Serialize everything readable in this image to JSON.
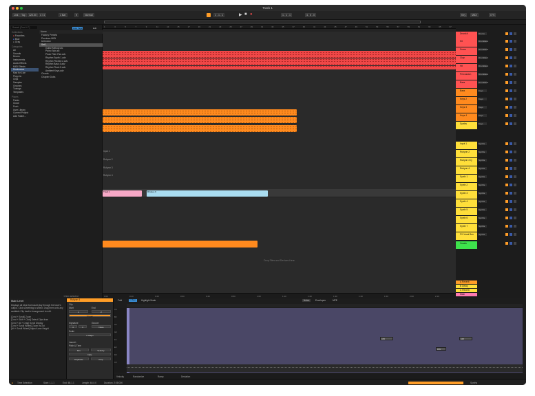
{
  "window": {
    "title": "Track 1"
  },
  "transport": {
    "link": "Link",
    "tap": "Tap",
    "tempo": "120.00",
    "meter": "4 / 4",
    "quant": "1 Bar",
    "position": "1 . 1 . 1",
    "loop_start": "1 . 1 . 1",
    "loop_len": "4 . 0 . 0",
    "key": "Key",
    "midi": "MIDI",
    "cpu": "0 %",
    "mode": "Normal"
  },
  "browser": {
    "search_placeholder": "Search (Cmd + F)",
    "collections_header": "Collections",
    "collections": [
      "Favorites",
      "Blue",
      "Gray"
    ],
    "categories_header": "Categories",
    "categories": [
      "All",
      "Sounds",
      "Drums",
      "Instruments",
      "Audio Effects",
      "MIDI Effects",
      "Modulators",
      "Max for Live",
      "Plug-Ins",
      "Clips",
      "Samples",
      "Grooves",
      "Tunings",
      "Templates"
    ],
    "places_header": "Places",
    "places": [
      "Packs",
      "Cloud",
      "Push",
      "User Library",
      "Current Project",
      "Add Folder..."
    ],
    "column_header": "Name",
    "auto_tags": "Auto Tags",
    "edit": "Edit",
    "files": [
      "Factory Presets",
      "Previews MIDI",
      "Unknown",
      "Set 1",
      "Guitar Melody.alc",
      "Paino Sub.alc",
      "Pluck Filter Pad.adv",
      "Rhythm Synth 1.adv",
      "Rhythm Pitched 2.adv",
      "Rhythm Bass 4.adv",
      "Rhythm Pluck 5.adv",
      "Ambient Keys.adv",
      "Chords",
      "Chapter Dubs"
    ],
    "footer": "1 item selected"
  },
  "ruler": [
    "1",
    "3",
    "5",
    "7",
    "9",
    "11",
    "13",
    "15",
    "17",
    "19",
    "21",
    "23",
    "25",
    "27",
    "29",
    "31",
    "33",
    "35",
    "37",
    "39",
    "41",
    "43",
    "45",
    "47",
    "49",
    "51",
    "53",
    "55",
    "57",
    "59",
    "61",
    "63",
    "65",
    "67"
  ],
  "timebar": [
    "0:00",
    "0:10",
    "0:20",
    "0:30",
    "0:40",
    "0:50",
    "1:00",
    "1:10",
    "1:20",
    "1:30",
    "1:40",
    "1:50",
    "2:00",
    "2:10"
  ],
  "arrangement": {
    "drop_hint": "Drop Files and Devices Here",
    "ghost_clips": [
      "Input 1",
      "Rubyon 2",
      "Rubyon 3",
      "Rubyon 4"
    ],
    "clip_labels": [
      "Track 1",
      "Rhodes 9"
    ]
  },
  "mixer": {
    "tracks": [
      {
        "name": "Drumkit",
        "color": "#ff5252",
        "io": "Drums"
      },
      {
        "name": "Kit",
        "color": "#ff5252",
        "io": "DrumRack"
      },
      {
        "name": "Snare",
        "color": "#ff5252",
        "io": "DrumRack"
      },
      {
        "name": "Clap",
        "color": "#ff5252",
        "io": "DrumRack"
      },
      {
        "name": "Hit",
        "color": "#ff5252",
        "io": "DrumRack"
      },
      {
        "name": "Percussion",
        "color": "#ff5252",
        "io": "DrumRack"
      },
      {
        "name": "Bass",
        "color": "#ff5252",
        "io": "DrumRack"
      },
      {
        "name": "Bass",
        "color": "#ff8a1e",
        "io": "Keys"
      },
      {
        "name": "Keys 2",
        "color": "#ff8a1e",
        "io": "Keys"
      },
      {
        "name": "Keys 3",
        "color": "#ff8a1e",
        "io": "Keys"
      },
      {
        "name": "Keys 4",
        "color": "#ff8a1e",
        "io": "Keys"
      },
      {
        "name": "Synths",
        "color": "#ffdf3a",
        "io": "Keys"
      },
      {
        "name": "Input 1",
        "color": "#ffdf3a",
        "io": "Synths"
      },
      {
        "name": "Rubyon 2",
        "color": "#ffdf3a",
        "io": "Synths"
      },
      {
        "name": "Rubyon 3 Q",
        "color": "#ffdf3a",
        "io": "Synths"
      },
      {
        "name": "Rubyon 4",
        "color": "#ffdf3a",
        "io": "Synths"
      },
      {
        "name": "Synth 1",
        "color": "#ffdf3a",
        "io": "Synths"
      },
      {
        "name": "Synth 2",
        "color": "#ffdf3a",
        "io": "Synths"
      },
      {
        "name": "Synth 3",
        "color": "#ffdf3a",
        "io": "Synths"
      },
      {
        "name": "Synth 4",
        "color": "#ffdf3a",
        "io": "Synths"
      },
      {
        "name": "Synth 5",
        "color": "#ffdf3a",
        "io": "Synths"
      },
      {
        "name": "Synth 6",
        "color": "#ffdf3a",
        "io": "Synths"
      },
      {
        "name": "Synth 7",
        "color": "#ffdf3a",
        "io": "Synths"
      },
      {
        "name": "FX Vocal Bus",
        "color": "#ffdf3a",
        "io": "Synths"
      },
      {
        "name": "Vocals",
        "color": "#3ee24c",
        "io": ""
      }
    ],
    "returns": [
      {
        "name": "A Reverb",
        "color": "#ff9d27"
      },
      {
        "name": "B Delay",
        "color": "#ffdf3a"
      },
      {
        "name": "C Reverb",
        "color": "#ffdf3a"
      },
      {
        "name": "Main",
        "color": "#ff7ab0"
      }
    ]
  },
  "info": {
    "title": "Main Level",
    "body": "Displays all clips that would play through the track's output. Click something to select. Drag them onto any available Clip track's Arrangement to edit.\n\n[Cmd + Scroll] Zoom\n[Cmd + Shift + Click] Select Clips from\n[Cmd + Alt + Drag] Scroll Display\n[Cmd + Scroll Wheel] Zoom In/Out\n[Alt + Scroll Wheel] Adjust Lane Height"
  },
  "clipview": {
    "clip_name": "Rubyon 4",
    "clip": "Clip",
    "start": "Start",
    "end": "End",
    "signature": "Signature",
    "groove": "Groove",
    "start_val": "1",
    "end_val": "2",
    "sig_num": "4",
    "sig_den": "4",
    "groove_val": "None",
    "scale": "Scale",
    "scale_val": "C Major",
    "launch": "Launch",
    "pitch": "Pitch & Time",
    "duplicate": "Duplicate",
    "crop": "Crop",
    "mode_val": "Trigger",
    "reverse": "Rev",
    "velocity": "Velocity",
    "note_val": "Note"
  },
  "editor": {
    "tabs": [
      "Notes",
      "Envelopes",
      "MPE"
    ],
    "highlight": "Highlight Scale",
    "fold": "Fold",
    "scale_btn": "C Major",
    "notes": [
      "A#3",
      "A#3",
      "F#3"
    ],
    "bottom": {
      "velocity": "Velocity",
      "randomize": "Randomize",
      "ramp": "Ramp",
      "deviation": "Deviation"
    },
    "key_labels": [
      "C4",
      "B3",
      "A3",
      "G3",
      "F3",
      "E3",
      "D3",
      "C3"
    ]
  },
  "status": {
    "left": "Time Selection",
    "start": "Start: 1.1.1",
    "end": "End: 65.1.1",
    "length": "Length: 64.0.0",
    "duration": "Duration: 2:08:000",
    "track": "Synths"
  }
}
